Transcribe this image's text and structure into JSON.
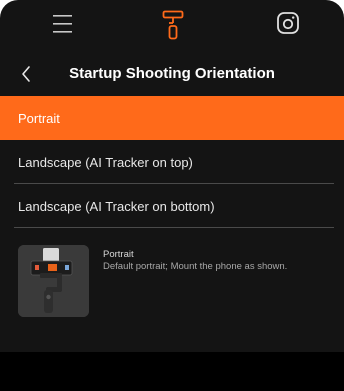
{
  "topbar": {
    "left_icon": "hamburger-menu-icon",
    "center_icon": "gimbal-icon",
    "right_icon": "camera-app-icon",
    "accent_color": "#ff6a1a"
  },
  "navbar": {
    "back_icon": "chevron-left-icon",
    "title": "Startup Shooting Orientation"
  },
  "options": [
    {
      "label": "Portrait",
      "selected": true
    },
    {
      "label": "Landscape (AI Tracker on top)",
      "selected": false
    },
    {
      "label": "Landscape (AI Tracker on bottom)",
      "selected": false
    }
  ],
  "description": {
    "title": "Portrait",
    "text": "Default portrait; Mount the phone as shown."
  }
}
